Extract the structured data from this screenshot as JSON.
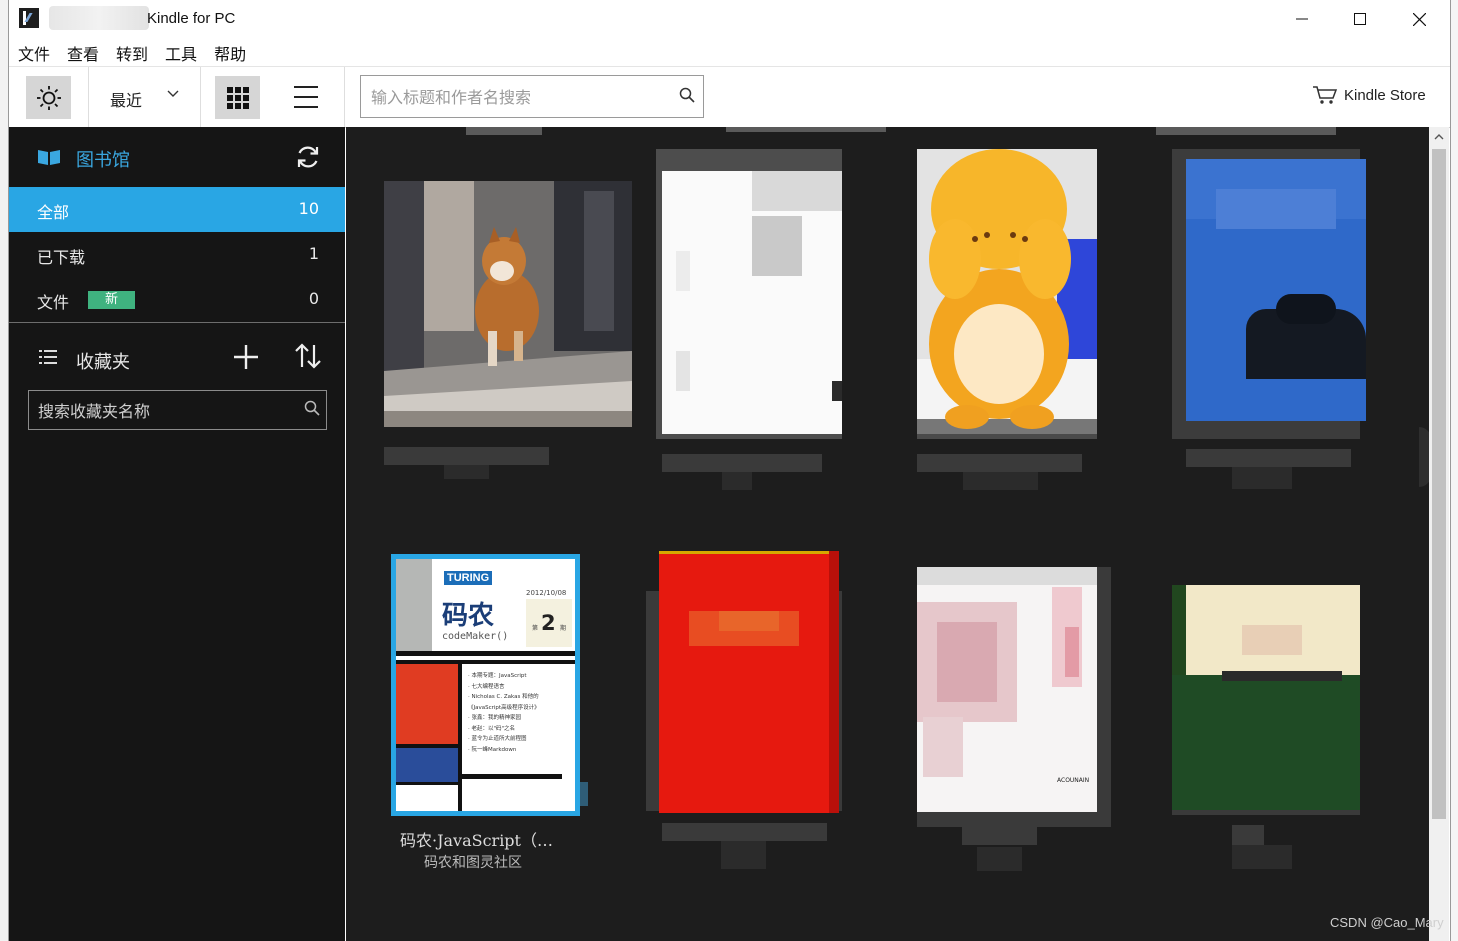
{
  "window": {
    "title": "Kindle for PC",
    "controls": {
      "minimize": "—",
      "maximize": "☐",
      "close": "✕"
    }
  },
  "menu": [
    "文件",
    "查看",
    "转到",
    "工具",
    "帮助"
  ],
  "toolbar": {
    "sort_label": "最近",
    "search_placeholder": "输入标题和作者名搜索",
    "store_label": "Kindle Store"
  },
  "sidebar": {
    "library_title": "图书馆",
    "items": [
      {
        "label": "全部",
        "count": "10",
        "active": true
      },
      {
        "label": "已下载",
        "count": "1",
        "active": false
      },
      {
        "label": "文件",
        "count": "0",
        "badge": "新",
        "active": false
      }
    ],
    "collections_title": "收藏夹",
    "collections_search_placeholder": "搜索收藏夹名称"
  },
  "books": [
    {
      "title": "码农·JavaScript（…",
      "author": "码农和图灵社区"
    }
  ],
  "coder_cover": {
    "publisher": "TURING",
    "title_cn": "码农",
    "code_maker": "codeMaker()",
    "date": "2012/10/08",
    "issue_num": "2",
    "issue_prefix": "第",
    "issue_suffix": "期",
    "toc": [
      "· 本期专题：JavaScript",
      "· 七大编程语言",
      "· Nicholas C. Zakas 和他的",
      "  《JavaScript高级程序设计》",
      "· 张鑫：我的精神家园",
      "· 老赵：以\"码\"之名",
      "· 蓝令为止道所大前程图",
      "· 阮一峰Markdown"
    ]
  },
  "other_cover_text": "ACOUNAIN",
  "watermark": "CSDN @Cao_Mary",
  "colors": {
    "accent_blue": "#29a6e4",
    "library_title_blue": "#3aa7e0",
    "new_badge_green": "#3fb27f",
    "sidebar_bg": "#151515",
    "grid_bg": "#1d1d1d"
  }
}
